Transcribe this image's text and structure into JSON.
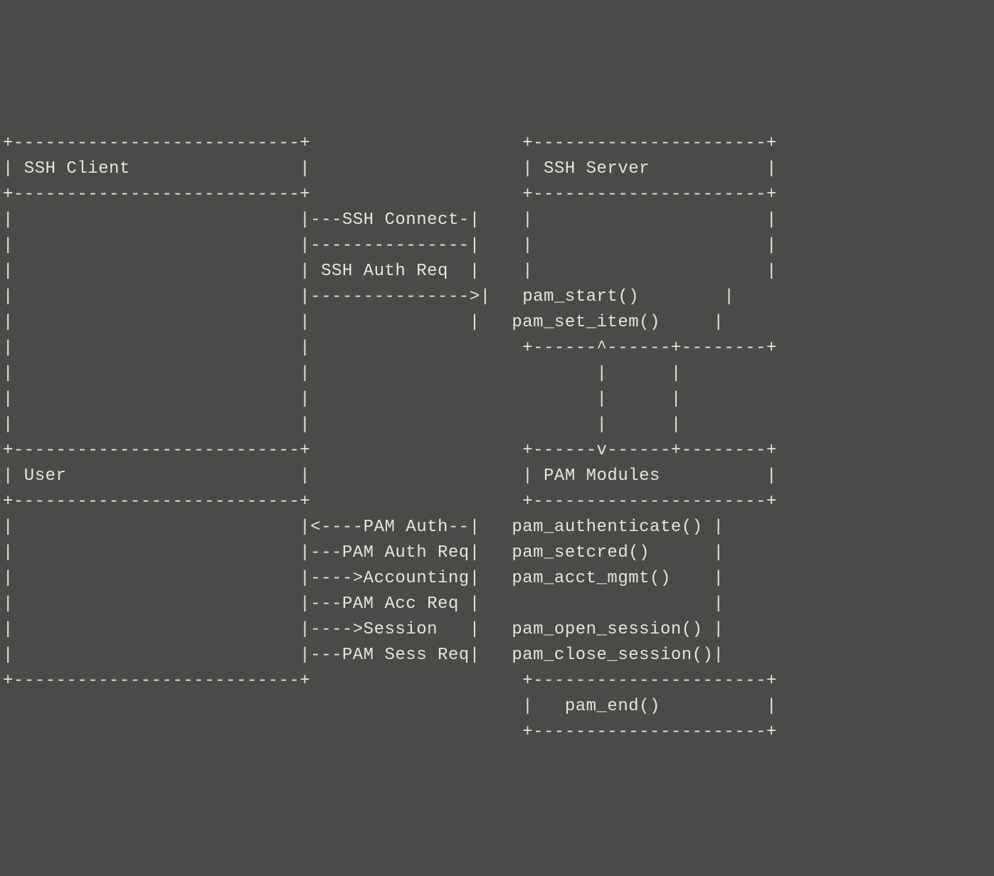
{
  "diagram": {
    "lines": [
      "+---------------------------+                    +----------------------+",
      "| SSH Client                |                    | SSH Server           |",
      "+---------------------------+                    +----------------------+",
      "|                           |---SSH Connect-|    |                      |",
      "|                           |---------------|    |                      |",
      "|                           | SSH Auth Req  |    |                      |",
      "|                           |--------------->|   pam_start()        |",
      "|                           |               |   pam_set_item()     |",
      "|                           |                    +------^------+--------+",
      "|                           |                           |      |",
      "|                           |                           |      |",
      "|                           |                           |      |",
      "+---------------------------+                    +------v------+--------+",
      "| User                      |                    | PAM Modules          |",
      "+---------------------------+                    +----------------------+",
      "|                           |<----PAM Auth--|   pam_authenticate() |",
      "|                           |---PAM Auth Req|   pam_setcred()      |",
      "|                           |---->Accounting|   pam_acct_mgmt()    |",
      "|                           |---PAM Acc Req |                      |",
      "|                           |---->Session   |   pam_open_session() |",
      "|                           |---PAM Sess Req|   pam_close_session()|",
      "+---------------------------+                    +----------------------+",
      "                                                 |   pam_end()          |",
      "                                                 +----------------------+"
    ],
    "entities": {
      "client": "SSH Client",
      "server": "SSH Server",
      "user": "User",
      "pam_modules": "PAM Modules"
    },
    "messages": {
      "ssh_connect": "SSH Connect",
      "ssh_auth_req": "SSH Auth Req",
      "pam_auth": "PAM Auth",
      "pam_auth_req": "PAM Auth Req",
      "accounting": "Accounting",
      "pam_acc_req": "PAM Acc Req",
      "session": "Session",
      "pam_sess_req": "PAM Sess Req"
    },
    "functions": {
      "pam_start": "pam_start()",
      "pam_set_item": "pam_set_item()",
      "pam_authenticate": "pam_authenticate()",
      "pam_setcred": "pam_setcred()",
      "pam_acct_mgmt": "pam_acct_mgmt()",
      "pam_open_session": "pam_open_session()",
      "pam_close_session": "pam_close_session()",
      "pam_end": "pam_end()"
    }
  }
}
